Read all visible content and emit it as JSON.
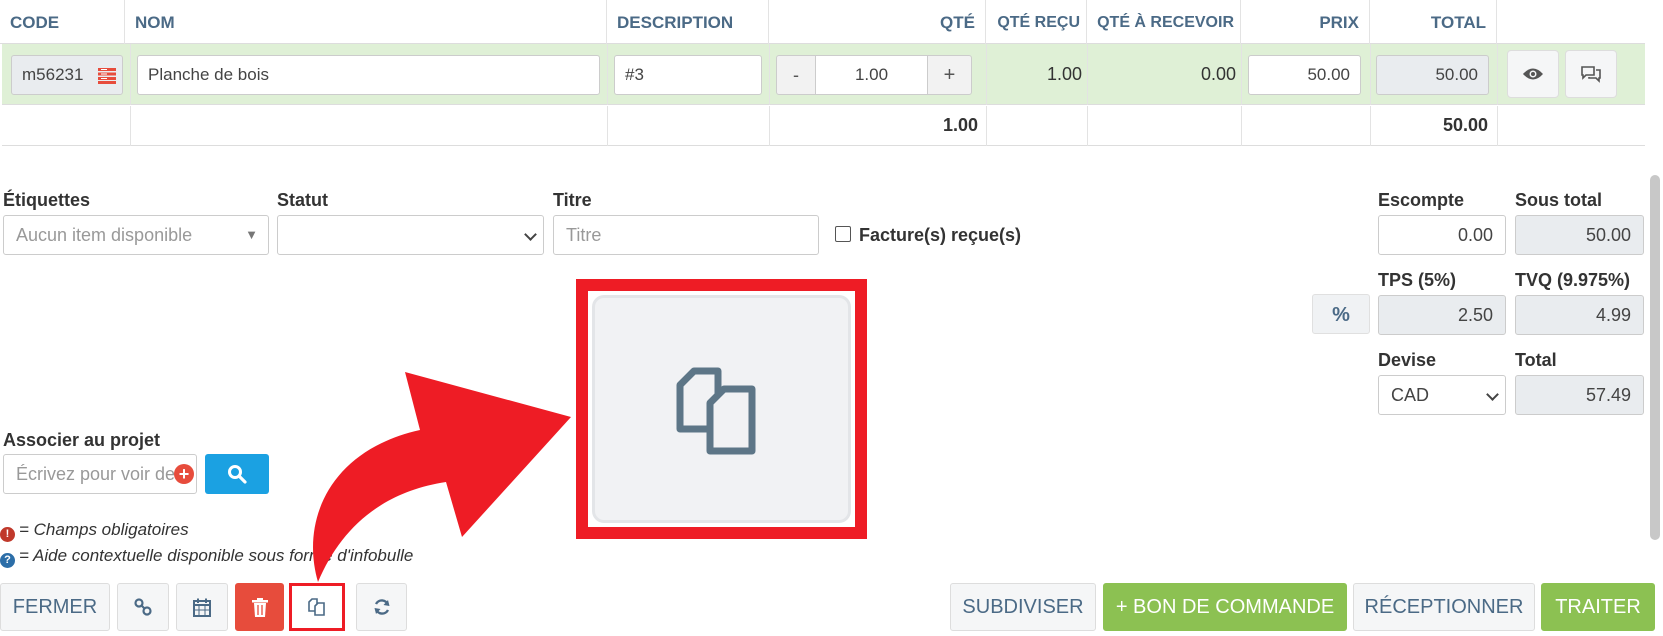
{
  "table": {
    "headers": {
      "code": "CODE",
      "nom": "NOM",
      "description": "DESCRIPTION",
      "qte": "QTÉ",
      "qte_recu": "QTÉ REÇU",
      "qte_a_recevoir": "QTÉ À RECEVOIR",
      "prix": "PRIX",
      "total": "TOTAL"
    },
    "row": {
      "code": "m56231",
      "nom": "Planche de bois",
      "description": "#3",
      "qte_minus": "-",
      "qte": "1.00",
      "qte_plus": "+",
      "qte_recu": "1.00",
      "qte_a_recevoir": "0.00",
      "prix": "50.00",
      "total": "50.00"
    },
    "totals": {
      "qte": "1.00",
      "total": "50.00"
    }
  },
  "form": {
    "etiquettes_label": "Étiquettes",
    "etiquettes_placeholder": "Aucun item disponible",
    "statut_label": "Statut",
    "titre_label": "Titre",
    "titre_placeholder": "Titre",
    "facture_label": "Facture(s) reçue(s)",
    "associer_label": "Associer au projet",
    "associer_placeholder": "Écrivez pour voir des"
  },
  "summary": {
    "escompte_label": "Escompte",
    "escompte_value": "0.00",
    "sous_total_label": "Sous total",
    "sous_total_value": "50.00",
    "percent_label": "%",
    "tps_label": "TPS (5%)",
    "tps_value": "2.50",
    "tvq_label": "TVQ (9.975%)",
    "tvq_value": "4.99",
    "devise_label": "Devise",
    "devise_value": "CAD",
    "total_label": "Total",
    "total_value": "57.49"
  },
  "legends": {
    "required": "= Champs obligatoires",
    "help": "= Aide contextuelle disponible sous forme d'infobulle"
  },
  "buttons": {
    "fermer": "FERMER",
    "subdiviser": "SUBDIVISER",
    "bon_de_commande": "+ BON DE COMMANDE",
    "receptionner": "RÉCEPTIONNER",
    "traiter": "TRAITER"
  },
  "colors": {
    "accent_green": "#8cc152",
    "header_blue": "#4b6a86",
    "search_blue": "#1ba1e2",
    "highlight_red": "#ee1c25",
    "row_green": "#dff0d6"
  }
}
